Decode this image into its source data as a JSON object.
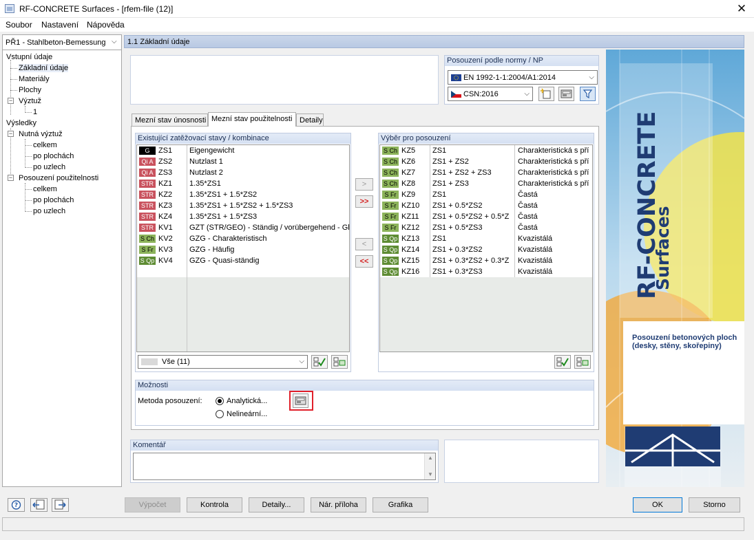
{
  "window": {
    "title": "RF-CONCRETE Surfaces - [rfem-file (12)]",
    "close_glyph": "✕"
  },
  "menu": [
    "Soubor",
    "Nastavení",
    "Nápověda"
  ],
  "nav": {
    "combo": "PŘ1 - Stahlbeton-Bemessung",
    "items": [
      {
        "label": "Vstupní údaje"
      },
      {
        "label": "Základní údaje"
      },
      {
        "label": "Materiály"
      },
      {
        "label": "Plochy"
      },
      {
        "label": "Výztuž"
      },
      {
        "label": "1"
      },
      {
        "label": "Výsledky"
      },
      {
        "label": "Nutná výztuž"
      },
      {
        "label": "celkem"
      },
      {
        "label": "po plochách"
      },
      {
        "label": "po uzlech"
      },
      {
        "label": "Posouzení použitelnosti"
      },
      {
        "label": "celkem"
      },
      {
        "label": "po plochách"
      },
      {
        "label": "po uzlech"
      }
    ]
  },
  "header": {
    "title": "1.1 Základní údaje"
  },
  "norm": {
    "title": "Posouzení podle normy / NP",
    "norm_value": "EN 1992-1-1:2004/A1:2014",
    "annex_value": "CSN:2016"
  },
  "tabs": [
    "Mezní stav únosnosti",
    "Mezní stav použitelnosti",
    "Detaily"
  ],
  "left_list": {
    "title": "Existující zatěžovací stavy /  kombinace",
    "rows": [
      {
        "badge": "G",
        "code": "ZS1",
        "desc": "Eigengewicht"
      },
      {
        "badge": "Qi A",
        "code": "ZS2",
        "desc": "Nutzlast 1"
      },
      {
        "badge": "Qi A",
        "code": "ZS3",
        "desc": "Nutzlast 2"
      },
      {
        "badge": "STR",
        "code": "KZ1",
        "desc": "1.35*ZS1"
      },
      {
        "badge": "STR",
        "code": "KZ2",
        "desc": "1.35*ZS1 + 1.5*ZS2"
      },
      {
        "badge": "STR",
        "code": "KZ3",
        "desc": "1.35*ZS1 + 1.5*ZS2 + 1.5*ZS3"
      },
      {
        "badge": "STR",
        "code": "KZ4",
        "desc": "1.35*ZS1 + 1.5*ZS3"
      },
      {
        "badge": "STR",
        "code": "KV1",
        "desc": "GZT (STR/GEO) - Ständig / vorübergehend - Gl"
      },
      {
        "badge": "S Ch",
        "code": "KV2",
        "desc": "GZG - Charakteristisch"
      },
      {
        "badge": "S Fr",
        "code": "KV3",
        "desc": "GZG - Häufig"
      },
      {
        "badge": "S Qp",
        "code": "KV4",
        "desc": "GZG - Quasi-ständig"
      }
    ],
    "filter": "Vše (11)"
  },
  "right_list": {
    "title": "Výběr pro posouzení",
    "rows": [
      {
        "badge": "S Ch",
        "code": "KZ5",
        "desc": "ZS1",
        "type": "Charakteristická s pří"
      },
      {
        "badge": "S Ch",
        "code": "KZ6",
        "desc": "ZS1 + ZS2",
        "type": "Charakteristická s pří"
      },
      {
        "badge": "S Ch",
        "code": "KZ7",
        "desc": "ZS1 + ZS2 + ZS3",
        "type": "Charakteristická s pří"
      },
      {
        "badge": "S Ch",
        "code": "KZ8",
        "desc": "ZS1 + ZS3",
        "type": "Charakteristická s pří"
      },
      {
        "badge": "S Fr",
        "code": "KZ9",
        "desc": "ZS1",
        "type": "Častá"
      },
      {
        "badge": "S Fr",
        "code": "KZ10",
        "desc": "ZS1 + 0.5*ZS2",
        "type": "Častá"
      },
      {
        "badge": "S Fr",
        "code": "KZ11",
        "desc": "ZS1 + 0.5*ZS2 + 0.5*Z",
        "type": "Častá"
      },
      {
        "badge": "S Fr",
        "code": "KZ12",
        "desc": "ZS1 + 0.5*ZS3",
        "type": "Častá"
      },
      {
        "badge": "S Qp",
        "code": "KZ13",
        "desc": "ZS1",
        "type": "Kvazistálá"
      },
      {
        "badge": "S Qp",
        "code": "KZ14",
        "desc": "ZS1 + 0.3*ZS2",
        "type": "Kvazistálá"
      },
      {
        "badge": "S Qp",
        "code": "KZ15",
        "desc": "ZS1 + 0.3*ZS2 + 0.3*Z",
        "type": "Kvazistálá"
      },
      {
        "badge": "S Qp",
        "code": "KZ16",
        "desc": "ZS1 + 0.3*ZS3",
        "type": "Kvazistálá"
      }
    ]
  },
  "transfer": {
    "add_one": ">",
    "add_all": ">>",
    "remove_one": "<",
    "remove_all": "<<"
  },
  "options": {
    "title": "Možnosti",
    "method_label": "Metoda posouzení:",
    "analytic": "Analytická...",
    "nonlinear": "Nelineární..."
  },
  "comment": {
    "title": "Komentář"
  },
  "brand": {
    "product": "RF-CONCRETE",
    "sub": "Surfaces",
    "desc": "Posouzení betonových ploch (desky, stěny, skořepiny)"
  },
  "buttons": {
    "calc": "Výpočet",
    "check": "Kontrola",
    "details": "Detaily...",
    "annex": "Nár. příloha",
    "graphics": "Grafika",
    "ok": "OK",
    "cancel": "Storno"
  },
  "colors": {
    "accent": "#0078d7",
    "header_blue": "#c9d6ea",
    "highlight_red": "#e0202a"
  }
}
